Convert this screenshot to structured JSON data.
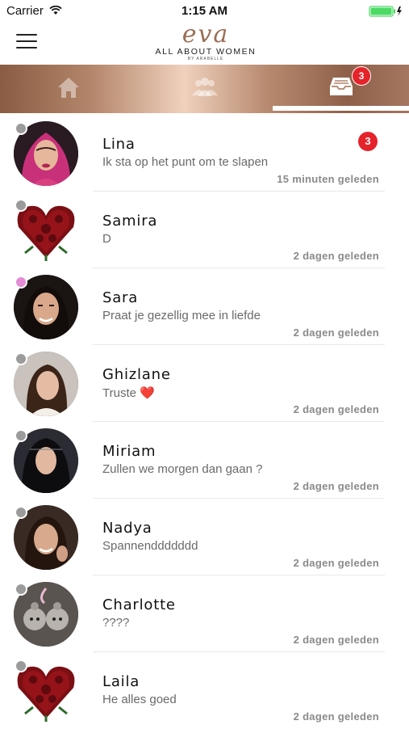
{
  "status_bar": {
    "carrier": "Carrier",
    "time": "1:15 AM",
    "battery_color": "#4cd964"
  },
  "header": {
    "logo_word": "eva",
    "logo_tagline": "ALL ABOUT WOMEN",
    "logo_sub": "BY ARABELLE",
    "menu_icon": "hamburger-menu-icon"
  },
  "tabs": [
    {
      "name": "home",
      "icon": "home-icon",
      "active": false
    },
    {
      "name": "friends",
      "icon": "people-icon",
      "active": false
    },
    {
      "name": "inbox",
      "icon": "inbox-icon",
      "active": true,
      "badge": "3"
    }
  ],
  "colors": {
    "accent_gradient_start": "#8a5c43",
    "accent_gradient_mid": "#f0d1bd",
    "badge_red": "#e5232b",
    "status_offline": "#9b9b9b",
    "status_online": "#e58ad4"
  },
  "conversations": [
    {
      "name": "Lina",
      "message": "Ik sta op het punt om te slapen",
      "time": "15 minuten geleden",
      "unread": "3",
      "status": "offline",
      "avatar": "woman-in-pink-hijab"
    },
    {
      "name": "Samira",
      "message": "D",
      "time": "2 dagen geleden",
      "status": "offline",
      "avatar": "red-roses-heart"
    },
    {
      "name": "Sara",
      "message": "Praat je gezellig mee in liefde",
      "time": "2 dagen geleden",
      "status": "online",
      "avatar": "woman-dark-hair"
    },
    {
      "name": "Ghizlane",
      "message": "Truste",
      "message_emoji": "❤️",
      "time": "2 dagen geleden",
      "status": "offline",
      "avatar": "woman-selfie"
    },
    {
      "name": "Miriam",
      "message": "Zullen we morgen dan gaan ?",
      "time": "2 dagen geleden",
      "status": "offline",
      "avatar": "woman-black-hijab"
    },
    {
      "name": "Nadya",
      "message": "Spannenddddddd",
      "time": "2 dagen geleden",
      "status": "offline",
      "avatar": "woman-smiling"
    },
    {
      "name": "Charlotte",
      "message": "????",
      "time": "2 dagen geleden",
      "status": "offline",
      "avatar": "teddy-bear"
    },
    {
      "name": "Laila",
      "message": "He alles goed",
      "time": "2 dagen geleden",
      "status": "offline",
      "avatar": "red-roses-heart"
    }
  ]
}
